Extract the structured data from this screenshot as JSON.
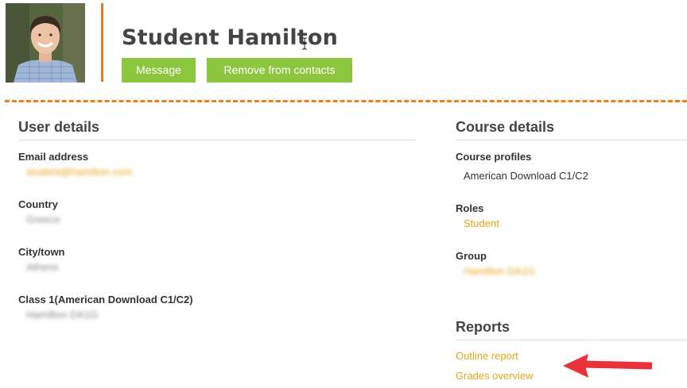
{
  "profile": {
    "name": "Student Hamilton",
    "avatar_icon": "user-photo",
    "accent_color": "#e07d1e"
  },
  "actions": {
    "message_label": "Message",
    "remove_label": "Remove from contacts",
    "button_color": "#8cc63f"
  },
  "user_details": {
    "title": "User details",
    "email_label": "Email address",
    "email_value": "student@hamilton.com",
    "country_label": "Country",
    "country_value": "Greece",
    "city_label": "City/town",
    "city_value": "Athens",
    "class_label": "Class 1(American Download C1/C2)",
    "class_value": "Hamilton DA1G"
  },
  "course_details": {
    "title": "Course details",
    "profiles_label": "Course profiles",
    "profiles_value": "American Download C1/C2",
    "roles_label": "Roles",
    "roles_value": "Student",
    "group_label": "Group",
    "group_value": "Hamilton DA1G"
  },
  "reports": {
    "title": "Reports",
    "outline_label": "Outline report",
    "grades_label": "Grades overview"
  },
  "annotation": {
    "arrow_color": "#e8333a"
  }
}
